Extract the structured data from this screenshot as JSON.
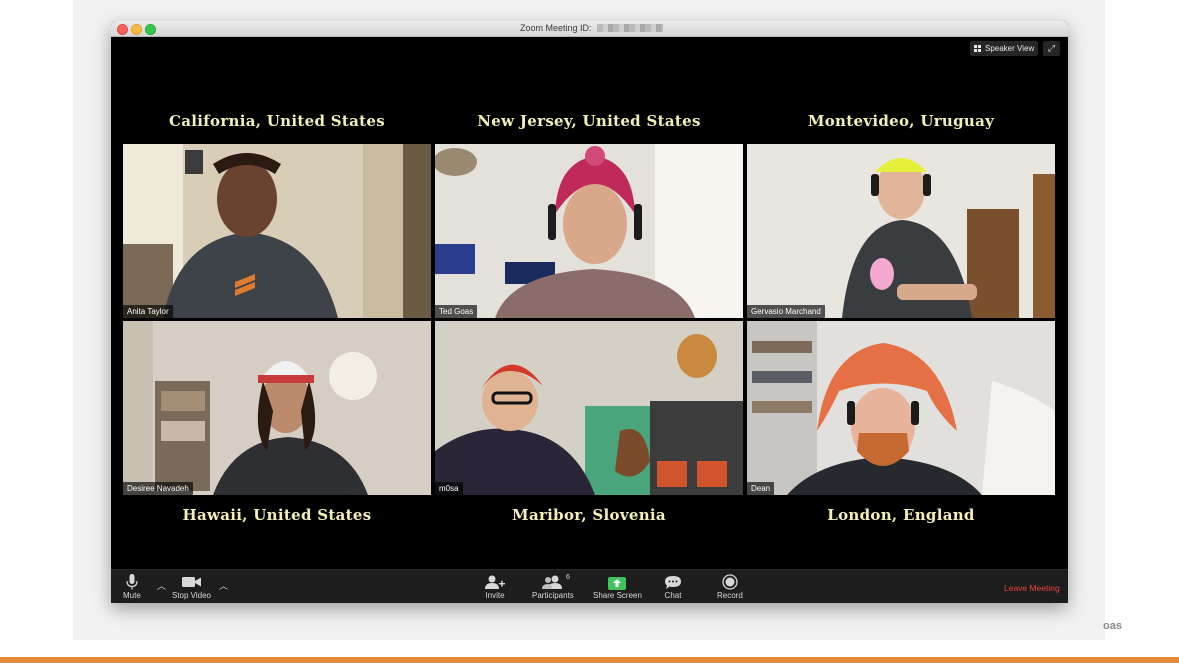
{
  "window": {
    "title": "Zoom Meeting ID:",
    "speaker_view_label": "Speaker View",
    "fullscreen_icon": "expand-icon"
  },
  "locations": [
    "California, United States",
    "New Jersey, United States",
    "Montevideo, Uruguay",
    "Hawaii, United States",
    "Maribor, Slovenia",
    "London, England"
  ],
  "participants": [
    {
      "name": "Anita Taylor"
    },
    {
      "name": "Ted Goas"
    },
    {
      "name": "Gervasio Marchand"
    },
    {
      "name": "Desiree Navadeh"
    },
    {
      "name": "m0sa"
    },
    {
      "name": "Dean"
    }
  ],
  "toolbar": {
    "mute": "Mute",
    "stop_video": "Stop Video",
    "invite": "Invite",
    "participants": "Participants",
    "participants_count": "6",
    "share_screen": "Share Screen",
    "chat": "Chat",
    "record": "Record",
    "leave": "Leave Meeting"
  },
  "slide": {
    "corner_text": "oas"
  },
  "colors": {
    "location_text": "#f2f0b8",
    "leave": "#e8453c",
    "share_green": "#3ec45a",
    "accent_bar": "#e58a3a"
  }
}
